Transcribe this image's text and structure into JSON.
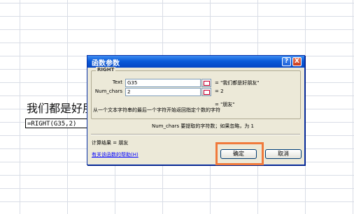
{
  "sheet": {
    "cell_text": "我们都是好朋",
    "formula": "=RIGHT(G35,2)"
  },
  "dialog": {
    "title": "函数参数",
    "help_symbol": "?",
    "close_symbol": "X",
    "function_name": "RIGHT",
    "args": [
      {
        "label": "Text",
        "value": "G35",
        "result": "= \"我们都是好朋友\""
      },
      {
        "label": "Num_chars",
        "value": "2",
        "result": "= 2"
      }
    ],
    "formula_result_preview": "= \"朋友\"",
    "description": "从一个文本字符串的最后一个字符开始返回指定个数的字符",
    "arg_help": "Num_chars  要提取的字符数；如果忽略，为 1",
    "calc_result": "计算结果 =  朋友",
    "help_link": "有关该函数的帮助(H)",
    "ok_label": "确定",
    "cancel_label": "取消"
  },
  "colors": {
    "highlight": "#f07a3c",
    "titlebar": "#0a5bd9",
    "dialog_bg": "#ece9d8"
  }
}
